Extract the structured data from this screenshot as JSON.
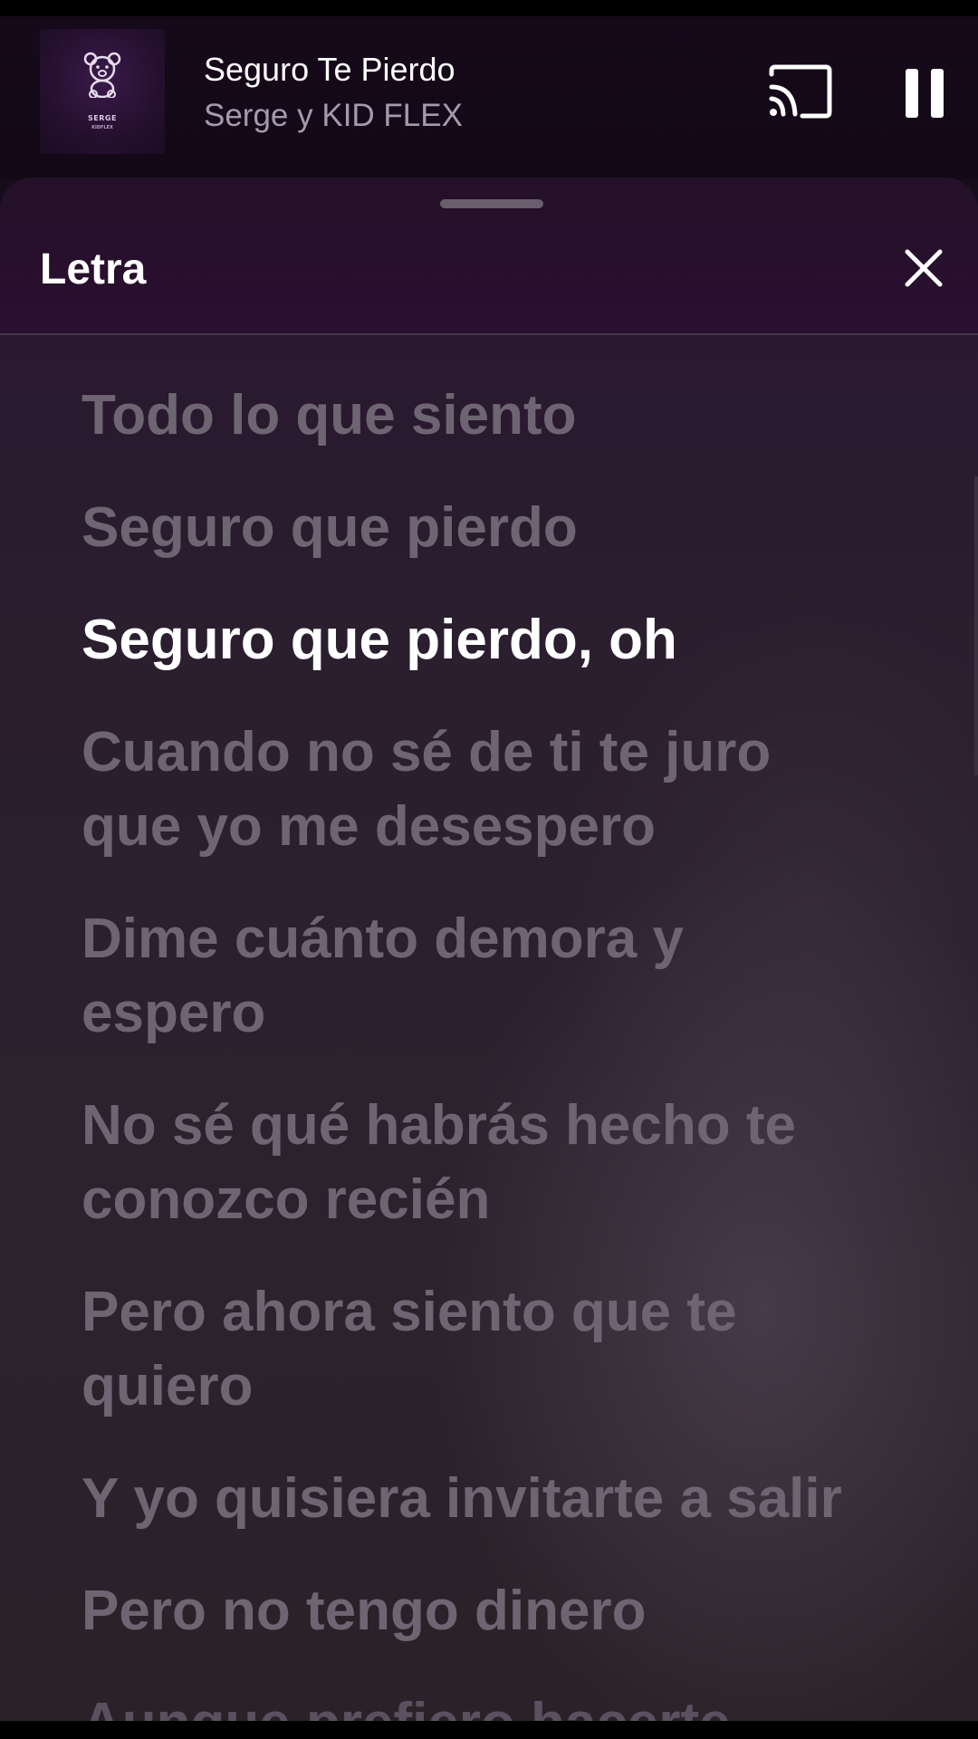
{
  "player": {
    "title": "Seguro Te Pierdo",
    "artist": "Serge y KID FLEX",
    "album_art_text": "SERGE",
    "album_art_subtext": "KIDFLEX",
    "icons": [
      "teddy-bear-icon",
      "cast-icon",
      "pause-icon"
    ]
  },
  "lyrics_sheet": {
    "title": "Letra",
    "icons": [
      "close-icon"
    ],
    "lines": [
      "Todo lo que siento",
      "Seguro que pierdo",
      "Seguro que pierdo, oh",
      "Cuando no sé de ti te juro\nque yo me desespero",
      "Dime cuánto demora y\nespero",
      "No sé qué habrás hecho te\nconozco recién",
      "Pero ahora siento que te\nquiero",
      "Y yo quisiera invitarte a salir",
      "Pero no tengo dinero",
      "Aunque prefiero hacerte"
    ],
    "active_line_index": 2
  },
  "colors": {
    "accent_purple": "#2a0f31",
    "active_lyric": "#ffffff",
    "inactive_lyric": "#6e6573"
  }
}
